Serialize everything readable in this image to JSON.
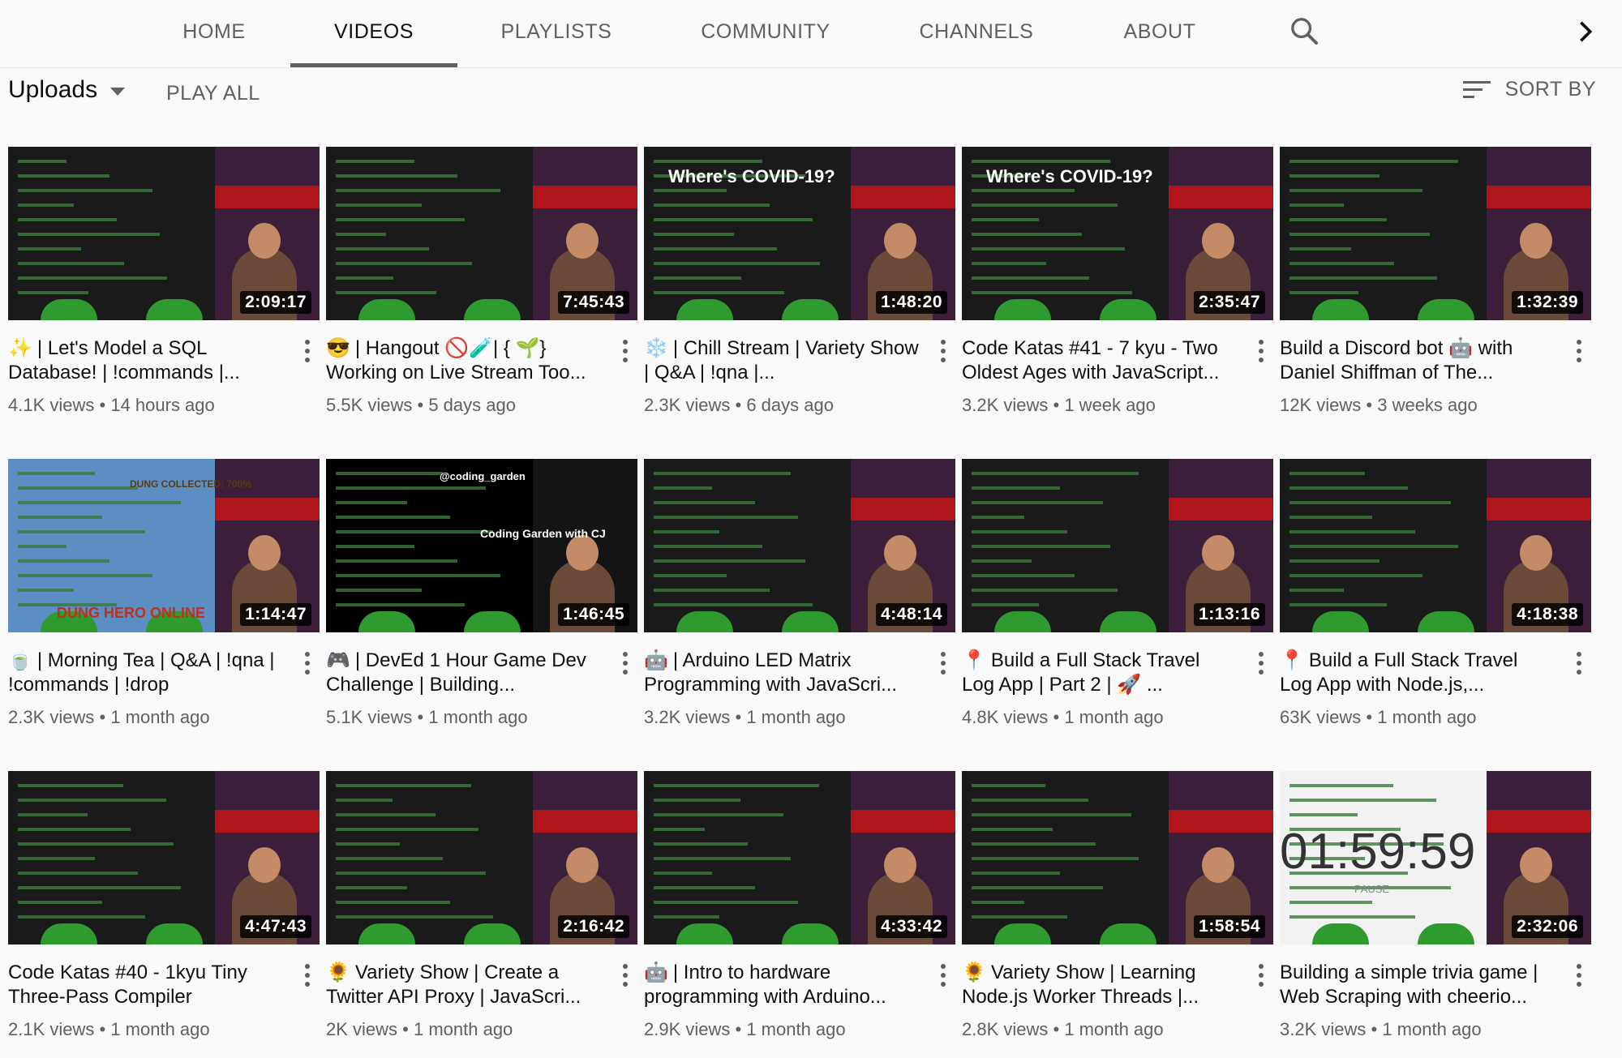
{
  "tabs": [
    {
      "label": "HOME",
      "active": false
    },
    {
      "label": "VIDEOS",
      "active": true
    },
    {
      "label": "PLAYLISTS",
      "active": false
    },
    {
      "label": "COMMUNITY",
      "active": false
    },
    {
      "label": "CHANNELS",
      "active": false
    },
    {
      "label": "ABOUT",
      "active": false
    }
  ],
  "filter": {
    "uploads_label": "Uploads",
    "play_all": "PLAY ALL",
    "sort_by": "SORT BY"
  },
  "videos": [
    {
      "emoji": "✨",
      "title": "| Let's Model a SQL Database! | !commands |...",
      "duration": "2:09:17",
      "views": "4.1K views",
      "age": "14 hours ago"
    },
    {
      "emoji": "😎",
      "title": "| Hangout 🚫🧪| { 🌱} Working on Live Stream Too...",
      "duration": "7:45:43",
      "views": "5.5K views",
      "age": "5 days ago"
    },
    {
      "emoji": "❄️",
      "title": "| Chill Stream | Variety Show | Q&A | !qna |...",
      "duration": "1:48:20",
      "views": "2.3K views",
      "age": "6 days ago"
    },
    {
      "emoji": "",
      "title": "Code Katas #41 - 7 kyu - Two Oldest Ages with JavaScript...",
      "duration": "2:35:47",
      "views": "3.2K views",
      "age": "1 week ago"
    },
    {
      "emoji": "",
      "title": "Build a Discord bot 🤖 with Daniel Shiffman of The...",
      "duration": "1:32:39",
      "views": "12K views",
      "age": "3 weeks ago"
    },
    {
      "emoji": "🍵",
      "title": "| Morning Tea | Q&A | !qna | !commands | !drop",
      "duration": "1:14:47",
      "views": "2.3K views",
      "age": "1 month ago"
    },
    {
      "emoji": "🎮",
      "title": "| DevEd 1 Hour Game Dev Challenge | Building...",
      "duration": "1:46:45",
      "views": "5.1K views",
      "age": "1 month ago"
    },
    {
      "emoji": "🤖",
      "title": "| Arduino LED Matrix Programming with JavaScri...",
      "duration": "4:48:14",
      "views": "3.2K views",
      "age": "1 month ago"
    },
    {
      "emoji": "📍",
      "title": "Build a Full Stack Travel Log App | Part 2 | 🚀 ...",
      "duration": "1:13:16",
      "views": "4.8K views",
      "age": "1 month ago"
    },
    {
      "emoji": "📍",
      "title": "Build a Full Stack Travel Log App with Node.js,...",
      "duration": "4:18:38",
      "views": "63K views",
      "age": "1 month ago"
    },
    {
      "emoji": "",
      "title": "Code Katas #40 - 1kyu Tiny Three-Pass Compiler",
      "duration": "4:47:43",
      "views": "2.1K views",
      "age": "1 month ago"
    },
    {
      "emoji": "🌻",
      "title": "Variety Show | Create a Twitter API Proxy | JavaScri...",
      "duration": "2:16:42",
      "views": "2K views",
      "age": "1 month ago"
    },
    {
      "emoji": "🤖",
      "title": "| Intro to hardware programming with Arduino...",
      "duration": "4:33:42",
      "views": "2.9K views",
      "age": "1 month ago"
    },
    {
      "emoji": "🌻",
      "title": "Variety Show | Learning Node.js Worker Threads |...",
      "duration": "1:58:54",
      "views": "2.8K views",
      "age": "1 month ago"
    },
    {
      "emoji": "",
      "title": "Building a simple trivia game | Web Scraping with cheerio...",
      "duration": "2:32:06",
      "views": "3.2K views",
      "age": "1 month ago"
    }
  ],
  "thumb_text": {
    "covid_title": "Where's COVID-19?",
    "coding_handle": "@coding_garden",
    "coding_card": "Coding Garden with CJ",
    "dung": "DUNG COLLECTED: 700%",
    "dung_hero": "DUNG HERO ONLINE",
    "timer": "01:59:59",
    "pause": "PAUSE"
  },
  "colors": {
    "bg": "#f9f9f9",
    "text": "#0f0f0f",
    "secondary": "#606060",
    "chat_red": "#b0151c",
    "chat_purple": "#3b1f3a"
  }
}
